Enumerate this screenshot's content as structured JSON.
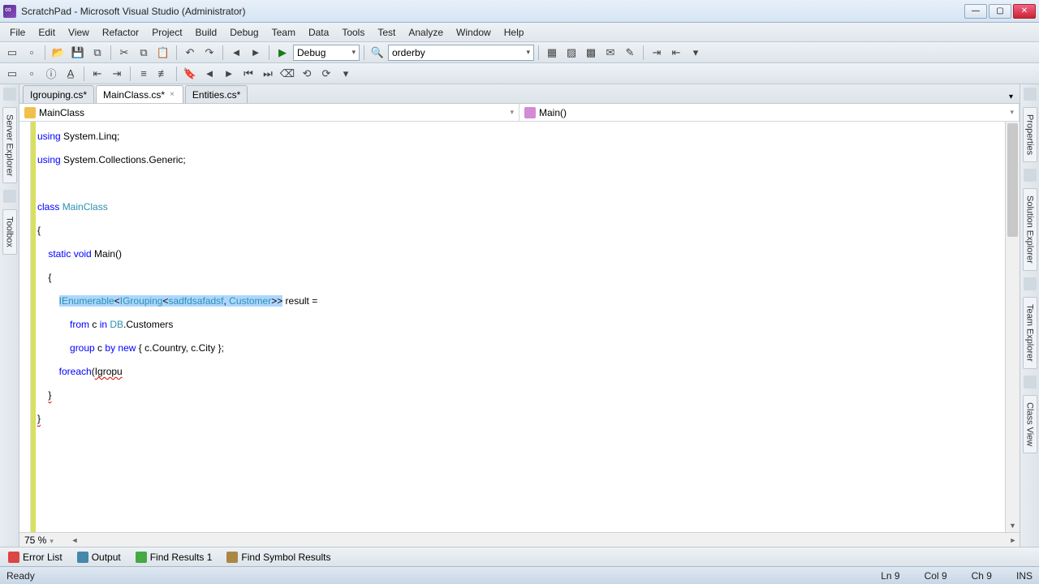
{
  "window": {
    "title": "ScratchPad - Microsoft Visual Studio (Administrator)"
  },
  "menu": {
    "items": [
      "File",
      "Edit",
      "View",
      "Refactor",
      "Project",
      "Build",
      "Debug",
      "Team",
      "Data",
      "Tools",
      "Test",
      "Analyze",
      "Window",
      "Help"
    ]
  },
  "toolbar1": {
    "config": "Debug",
    "search": "orderby"
  },
  "sidebars": {
    "left": [
      "Server Explorer",
      "Toolbox"
    ],
    "right": [
      "Properties",
      "Solution Explorer",
      "Team Explorer",
      "Class View"
    ]
  },
  "tabs": [
    {
      "label": "Igrouping.cs*",
      "active": false
    },
    {
      "label": "MainClass.cs*",
      "active": true
    },
    {
      "label": "Entities.cs*",
      "active": false
    }
  ],
  "navbar": {
    "class": "MainClass",
    "member": "Main()"
  },
  "code": {
    "lines": [
      {
        "tokens": [
          {
            "t": "using",
            "c": "kw"
          },
          {
            "t": " System.Linq;",
            "c": ""
          }
        ]
      },
      {
        "tokens": [
          {
            "t": "using",
            "c": "kw"
          },
          {
            "t": " System.Collections.Generic;",
            "c": ""
          }
        ]
      },
      {
        "tokens": []
      },
      {
        "tokens": [
          {
            "t": "class",
            "c": "kw"
          },
          {
            "t": " ",
            "c": ""
          },
          {
            "t": "MainClass",
            "c": "typ"
          }
        ]
      },
      {
        "tokens": [
          {
            "t": "{",
            "c": ""
          }
        ]
      },
      {
        "tokens": [
          {
            "t": "    ",
            "c": ""
          },
          {
            "t": "static",
            "c": "kw"
          },
          {
            "t": " ",
            "c": ""
          },
          {
            "t": "void",
            "c": "kw"
          },
          {
            "t": " Main()",
            "c": ""
          }
        ]
      },
      {
        "tokens": [
          {
            "t": "    {",
            "c": ""
          }
        ]
      },
      {
        "tokens": [
          {
            "t": "        ",
            "c": ""
          },
          {
            "t": "IEnumerable",
            "c": "typ hl"
          },
          {
            "t": "<",
            "c": "hl"
          },
          {
            "t": "IGrouping",
            "c": "typ hl"
          },
          {
            "t": "<",
            "c": "hl"
          },
          {
            "t": "sadfdsafadsf",
            "c": "typ hl"
          },
          {
            "t": ", ",
            "c": "hl"
          },
          {
            "t": "Customer",
            "c": "typ hl"
          },
          {
            "t": ">>",
            "c": "hl"
          },
          {
            "t": " result =",
            "c": ""
          }
        ]
      },
      {
        "tokens": [
          {
            "t": "            ",
            "c": ""
          },
          {
            "t": "from",
            "c": "kw"
          },
          {
            "t": " c ",
            "c": ""
          },
          {
            "t": "in",
            "c": "kw"
          },
          {
            "t": " ",
            "c": ""
          },
          {
            "t": "DB",
            "c": "typ"
          },
          {
            "t": ".Customers",
            "c": ""
          }
        ]
      },
      {
        "tokens": [
          {
            "t": "            ",
            "c": ""
          },
          {
            "t": "group",
            "c": "kw"
          },
          {
            "t": " c ",
            "c": ""
          },
          {
            "t": "by",
            "c": "kw"
          },
          {
            "t": " ",
            "c": ""
          },
          {
            "t": "new",
            "c": "kw"
          },
          {
            "t": " { c.Country, c.City };",
            "c": ""
          }
        ]
      },
      {
        "tokens": [
          {
            "t": "        ",
            "c": ""
          },
          {
            "t": "foreach",
            "c": "kw"
          },
          {
            "t": "(",
            "c": ""
          },
          {
            "t": "Igropu",
            "c": "squiggle"
          }
        ]
      },
      {
        "tokens": [
          {
            "t": "    ",
            "c": ""
          },
          {
            "t": "}",
            "c": "squiggle"
          }
        ]
      },
      {
        "tokens": [
          {
            "t": "}",
            "c": "squiggle"
          }
        ]
      }
    ]
  },
  "zoom": "75 %",
  "tooltabs": [
    "Error List",
    "Output",
    "Find Results 1",
    "Find Symbol Results"
  ],
  "status": {
    "ready": "Ready",
    "ln": "Ln 9",
    "col": "Col 9",
    "ch": "Ch 9",
    "ins": "INS"
  }
}
